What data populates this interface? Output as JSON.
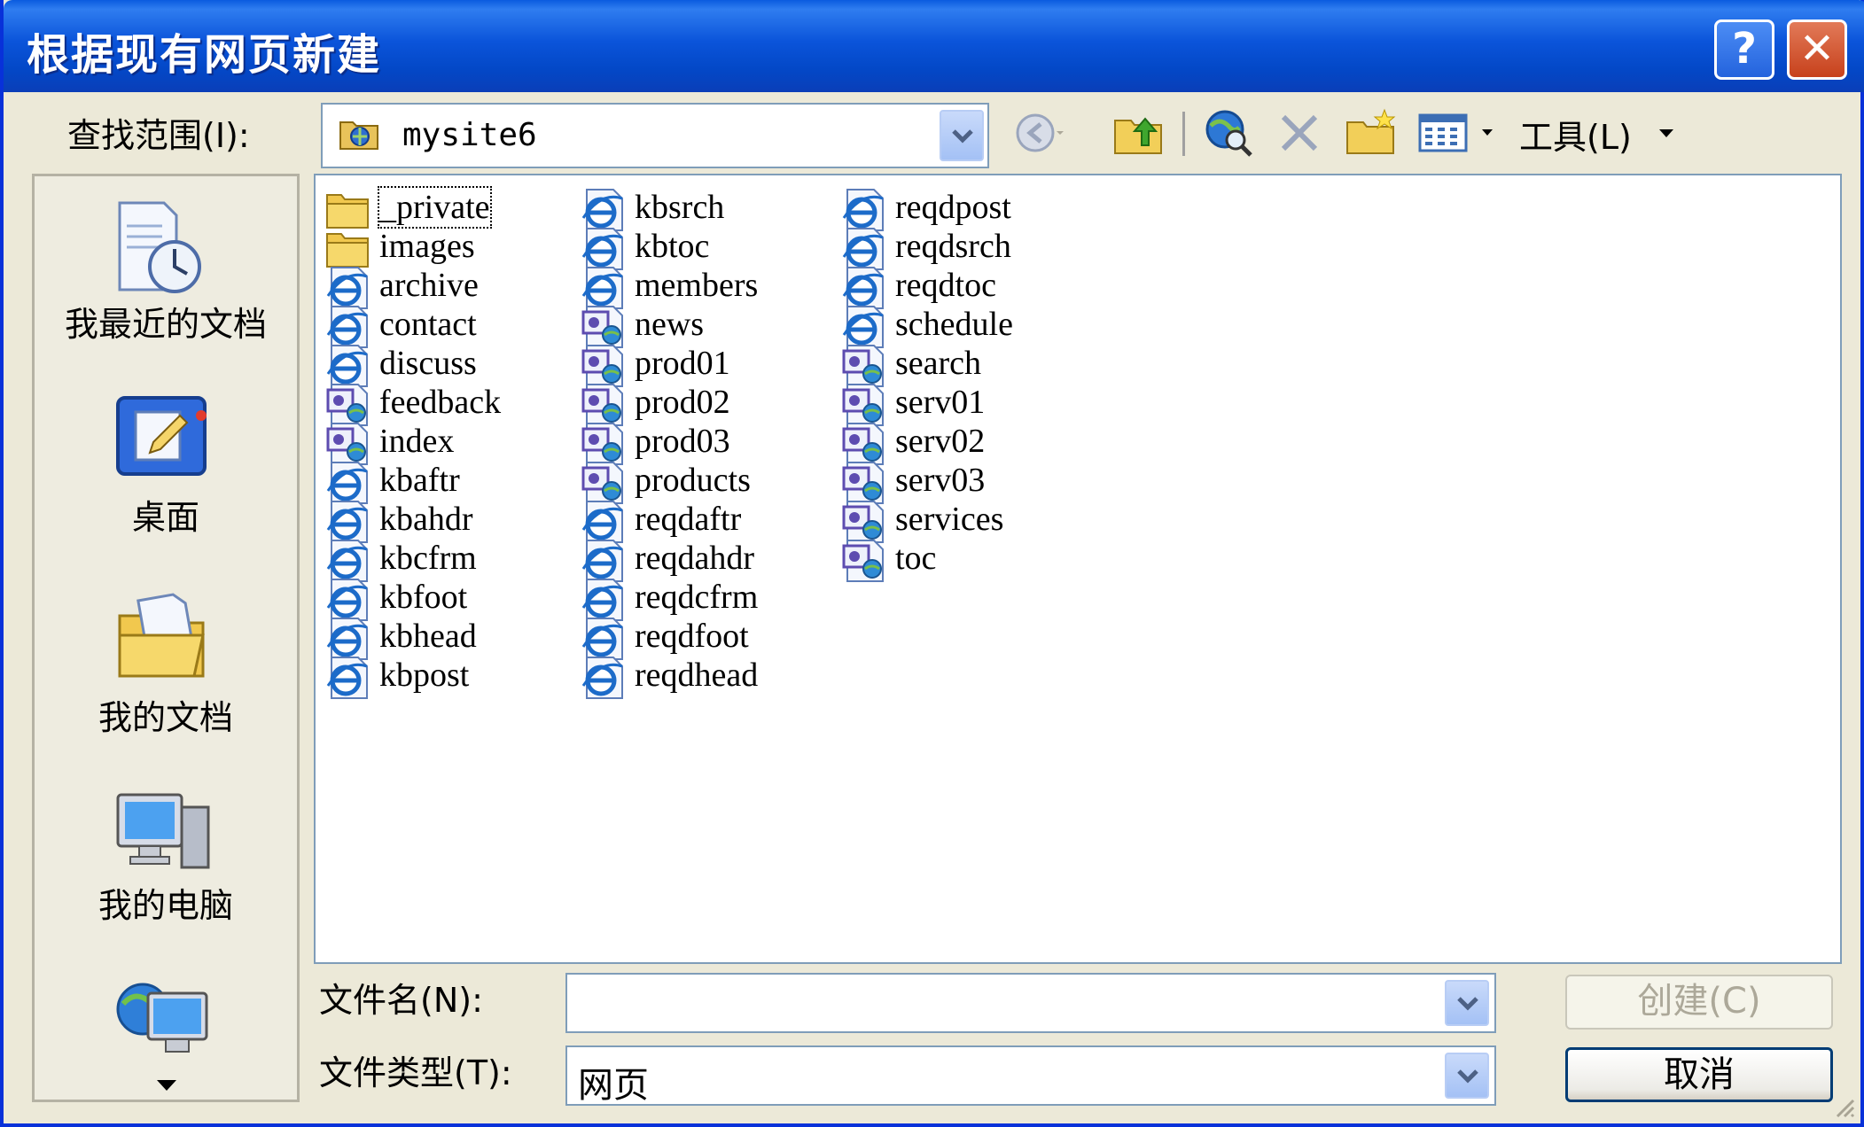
{
  "window": {
    "title": "根据现有网页新建",
    "help_glyph": "?",
    "close_glyph": "✕"
  },
  "lookin": {
    "label": "查找范围(I):",
    "value": "mysite6"
  },
  "toolbar": {
    "tools_label": "工具(L)"
  },
  "places": [
    {
      "label": "我最近的文档",
      "icon": "recent-documents-icon"
    },
    {
      "label": "桌面",
      "icon": "desktop-icon"
    },
    {
      "label": "我的文档",
      "icon": "my-documents-icon"
    },
    {
      "label": "我的电脑",
      "icon": "my-computer-icon"
    },
    {
      "label": "",
      "icon": "network-places-icon"
    }
  ],
  "files": [
    {
      "name": "_private",
      "type": "folder"
    },
    {
      "name": "images",
      "type": "folder"
    },
    {
      "name": "archive",
      "type": "ie"
    },
    {
      "name": "contact",
      "type": "ie"
    },
    {
      "name": "discuss",
      "type": "ie"
    },
    {
      "name": "feedback",
      "type": "page"
    },
    {
      "name": "index",
      "type": "page"
    },
    {
      "name": "kbaftr",
      "type": "ie"
    },
    {
      "name": "kbahdr",
      "type": "ie"
    },
    {
      "name": "kbcfrm",
      "type": "ie"
    },
    {
      "name": "kbfoot",
      "type": "ie"
    },
    {
      "name": "kbhead",
      "type": "ie"
    },
    {
      "name": "kbpost",
      "type": "ie"
    },
    {
      "name": "kbsrch",
      "type": "ie"
    },
    {
      "name": "kbtoc",
      "type": "ie"
    },
    {
      "name": "members",
      "type": "ie"
    },
    {
      "name": "news",
      "type": "page"
    },
    {
      "name": "prod01",
      "type": "page"
    },
    {
      "name": "prod02",
      "type": "page"
    },
    {
      "name": "prod03",
      "type": "page"
    },
    {
      "name": "products",
      "type": "page"
    },
    {
      "name": "reqdaftr",
      "type": "ie"
    },
    {
      "name": "reqdahdr",
      "type": "ie"
    },
    {
      "name": "reqdcfrm",
      "type": "ie"
    },
    {
      "name": "reqdfoot",
      "type": "ie"
    },
    {
      "name": "reqdhead",
      "type": "ie"
    },
    {
      "name": "reqdpost",
      "type": "ie"
    },
    {
      "name": "reqdsrch",
      "type": "ie"
    },
    {
      "name": "reqdtoc",
      "type": "ie"
    },
    {
      "name": "schedule",
      "type": "ie"
    },
    {
      "name": "search",
      "type": "page"
    },
    {
      "name": "serv01",
      "type": "page"
    },
    {
      "name": "serv02",
      "type": "page"
    },
    {
      "name": "serv03",
      "type": "page"
    },
    {
      "name": "services",
      "type": "page"
    },
    {
      "name": "toc",
      "type": "page"
    }
  ],
  "filename": {
    "label": "文件名(N):",
    "value": ""
  },
  "filetype": {
    "label": "文件类型(T):",
    "value": "网页"
  },
  "buttons": {
    "create": "创建(C)",
    "cancel": "取消"
  }
}
